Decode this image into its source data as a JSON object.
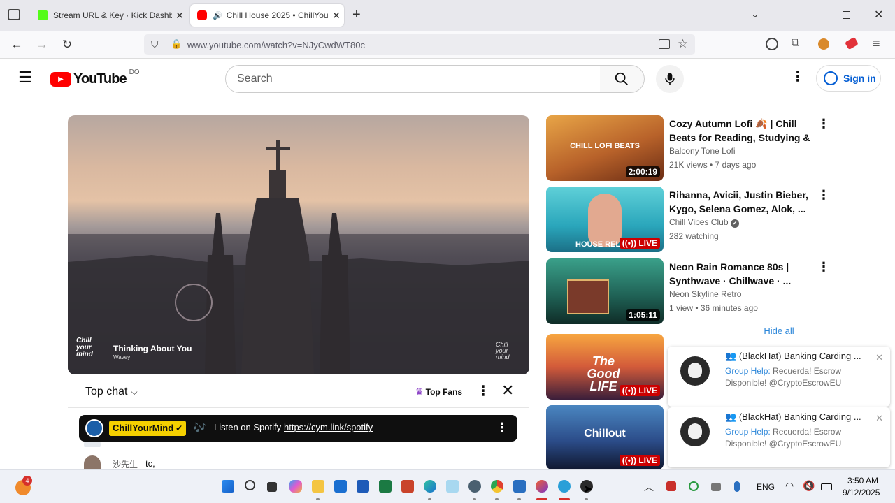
{
  "browser": {
    "tabs": [
      {
        "label": "Stream URL & Key · Kick Dashb"
      },
      {
        "label": "Chill House 2025 • ChillYou"
      }
    ],
    "url": "www.youtube.com/watch?v=NJyCwdWT80c"
  },
  "youtube": {
    "logo_text": "YouTube",
    "country_code": "DO",
    "search_placeholder": "Search",
    "sign_in": "Sign in"
  },
  "player": {
    "channel_logo": "Chill your mind",
    "song_title": "Thinking About You",
    "song_artist": "Wavey"
  },
  "chat": {
    "mode_label": "Top chat",
    "top_fans_label": "Top Fans",
    "pinned": {
      "author": "ChillYourMind",
      "note_glyph": "🎶",
      "text": "Listen on Spotify",
      "link": "https://cym.link/spotify"
    },
    "messages": [
      {
        "author": "沙先生",
        "text": "tc,"
      }
    ]
  },
  "recommendations": [
    {
      "title": "Cozy Autumn Lofi 🍂 | Chill Beats for Reading, Studying & ...",
      "channel": "Balcony Tone Lofi",
      "meta": "21K views • 7 days ago",
      "duration": "2:00:19",
      "thumb_text": "CHILL LOFI BEATS",
      "thumb_colors": [
        "#e8a547",
        "#9b4a1e"
      ]
    },
    {
      "title": "Rihanna, Avicii, Justin Bieber, Kygo, Selena Gomez, Alok, ...",
      "channel": "Chill Vibes Club",
      "meta": "282 watching",
      "duration": "LIVE",
      "thumb_text": "HOUSE RELAX",
      "thumb_colors": [
        "#5fd0d8",
        "#1b8aa0"
      ]
    },
    {
      "title": "Neon Rain Romance 80s | Synthwave · Chillwave · ...",
      "channel": "Neon Skyline Retro",
      "meta": "1 view • 36 minutes ago",
      "duration": "1:05:11",
      "thumb_text": "",
      "thumb_colors": [
        "#2f8b7a",
        "#123c36"
      ]
    },
    {
      "title": "",
      "channel": "",
      "meta": "",
      "duration": "LIVE",
      "thumb_text": "The Good LIFE",
      "thumb_colors": [
        "#f7a640",
        "#3a1e3a"
      ]
    },
    {
      "title": "",
      "channel": "",
      "meta": "",
      "duration": "LIVE",
      "thumb_text": "Chillout",
      "thumb_colors": [
        "#4a86c0",
        "#101830"
      ]
    }
  ],
  "notifications": {
    "hide_all": "Hide all",
    "items": [
      {
        "title": "(BlackHat) Banking Carding ...",
        "sender": "Group Help:",
        "body": "Recuerda! Escrow Disponible! @CryptoEscrowEU"
      },
      {
        "title": "(BlackHat) Banking Carding ...",
        "sender": "Group Help:",
        "body": "Recuerda! Escrow Disponible! @CryptoEscrowEU"
      }
    ]
  },
  "taskbar": {
    "badge_count": "4",
    "language": "ENG",
    "time": "3:50 AM",
    "date": "9/12/2025"
  },
  "colors": {
    "yt_red": "#ff0000",
    "link_blue": "#065fd4",
    "live_red": "#cc0000",
    "pinned_badge": "#f5d000"
  }
}
